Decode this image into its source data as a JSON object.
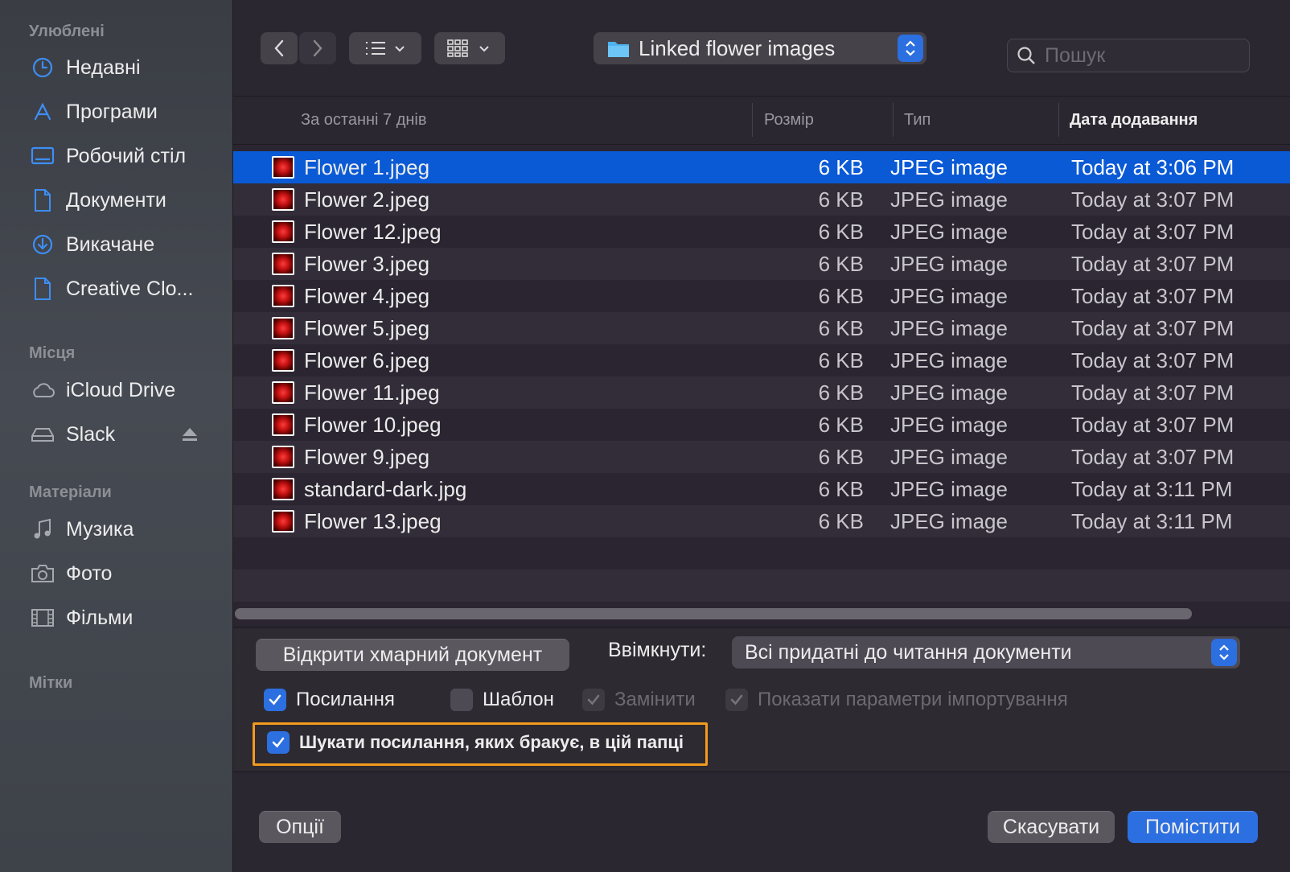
{
  "sidebar": {
    "sections": [
      {
        "title": "Улюблені"
      },
      {
        "title": "Місця"
      },
      {
        "title": "Матеріали"
      },
      {
        "title": "Мітки"
      }
    ],
    "favorites": [
      {
        "label": "Недавні",
        "icon": "clock-icon"
      },
      {
        "label": "Програми",
        "icon": "applications-icon"
      },
      {
        "label": "Робочий стіл",
        "icon": "desktop-icon"
      },
      {
        "label": "Документи",
        "icon": "document-icon"
      },
      {
        "label": "Викачане",
        "icon": "download-icon"
      },
      {
        "label": "Creative Clo...",
        "icon": "document-icon"
      }
    ],
    "locations": [
      {
        "label": "iCloud Drive",
        "icon": "cloud-icon"
      },
      {
        "label": "Slack",
        "icon": "drive-icon"
      }
    ],
    "media": [
      {
        "label": "Музика",
        "icon": "music-icon"
      },
      {
        "label": "Фото",
        "icon": "camera-icon"
      },
      {
        "label": "Фільми",
        "icon": "film-icon"
      }
    ]
  },
  "toolbar": {
    "folder_name": "Linked flower images",
    "search_placeholder": "Пошук"
  },
  "columns": {
    "name": "За останні 7 днів",
    "size": "Розмір",
    "type": "Тип",
    "date": "Дата додавання"
  },
  "files": [
    {
      "name": "Flower 1.jpeg",
      "size": "6 KB",
      "type": "JPEG image",
      "date": "Today at 3:06 PM",
      "selected": true
    },
    {
      "name": "Flower 2.jpeg",
      "size": "6 KB",
      "type": "JPEG image",
      "date": "Today at 3:07 PM"
    },
    {
      "name": "Flower 12.jpeg",
      "size": "6 KB",
      "type": "JPEG image",
      "date": "Today at 3:07 PM"
    },
    {
      "name": "Flower 3.jpeg",
      "size": "6 KB",
      "type": "JPEG image",
      "date": "Today at 3:07 PM"
    },
    {
      "name": "Flower 4.jpeg",
      "size": "6 KB",
      "type": "JPEG image",
      "date": "Today at 3:07 PM"
    },
    {
      "name": "Flower 5.jpeg",
      "size": "6 KB",
      "type": "JPEG image",
      "date": "Today at 3:07 PM"
    },
    {
      "name": "Flower 6.jpeg",
      "size": "6 KB",
      "type": "JPEG image",
      "date": "Today at 3:07 PM"
    },
    {
      "name": "Flower 11.jpeg",
      "size": "6 KB",
      "type": "JPEG image",
      "date": "Today at 3:07 PM"
    },
    {
      "name": "Flower 10.jpeg",
      "size": "6 KB",
      "type": "JPEG image",
      "date": "Today at 3:07 PM"
    },
    {
      "name": "Flower 9.jpeg",
      "size": "6 KB",
      "type": "JPEG image",
      "date": "Today at 3:07 PM"
    },
    {
      "name": "standard-dark.jpg",
      "size": "6 KB",
      "type": "JPEG image",
      "date": "Today at 3:11 PM"
    },
    {
      "name": "Flower 13.jpeg",
      "size": "6 KB",
      "type": "JPEG image",
      "date": "Today at 3:11 PM"
    }
  ],
  "options": {
    "open_cloud_label": "Відкрити хмарний документ",
    "enable_label": "Ввімкнути:",
    "enable_value": "Всі придатні до читання документи",
    "checkboxes": [
      {
        "label": "Посилання",
        "checked": true,
        "enabled": true
      },
      {
        "label": "Шаблон",
        "checked": false,
        "enabled": true
      },
      {
        "label": "Замінити",
        "checked": true,
        "enabled": false
      },
      {
        "label": "Показати параметри імпортування",
        "checked": true,
        "enabled": false
      }
    ],
    "search_missing_label": "Шукати посилання, яких бракує, в цій папці",
    "search_missing_checked": true
  },
  "footer": {
    "options_label": "Опції",
    "cancel_label": "Скасувати",
    "place_label": "Помістити"
  },
  "colors": {
    "accent": "#2c6fe0",
    "selection": "#0a5ad6",
    "highlight_border": "#f29b1e"
  }
}
